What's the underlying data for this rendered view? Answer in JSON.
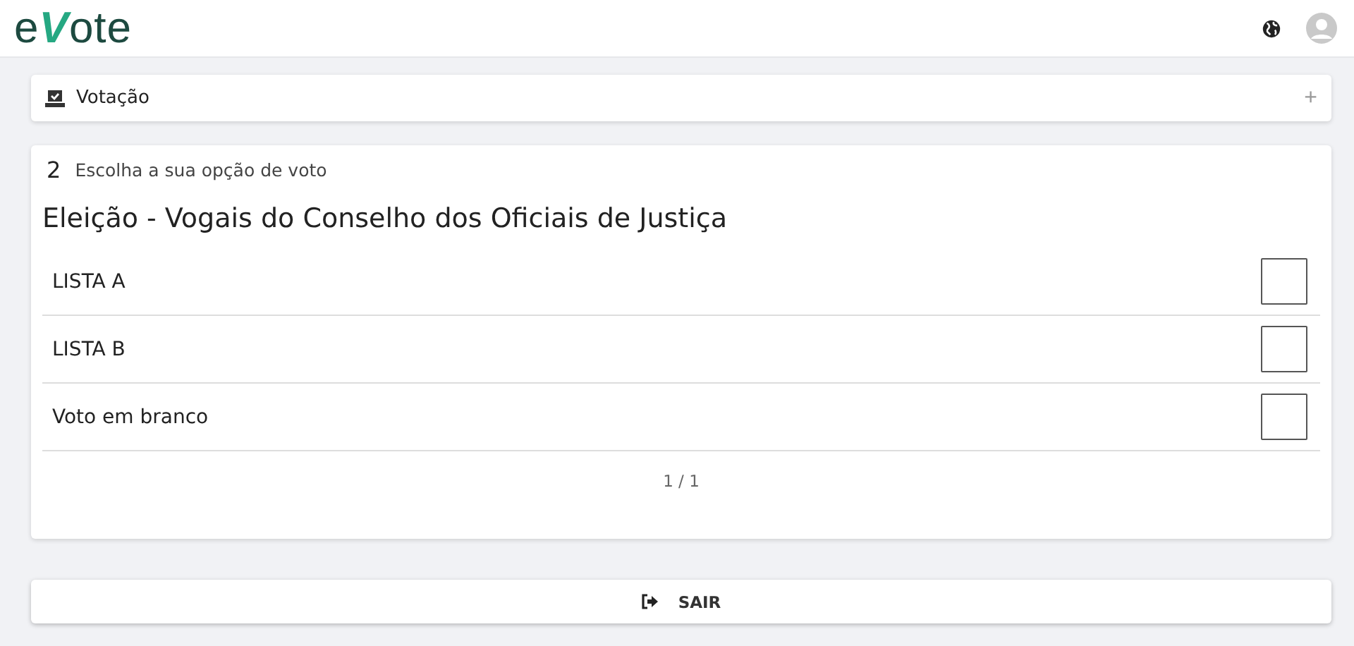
{
  "header": {
    "logo": "e**V**ote"
  },
  "accordion": {
    "title": "Votação",
    "expanded": false,
    "toggle": "+"
  },
  "ballot": {
    "step": "2",
    "instruction": "Escolha a sua opção de voto",
    "title": "Eleição - Vogais do Conselho dos Oficiais de Justiça",
    "options": [
      {
        "label": "LISTA A",
        "checked": false
      },
      {
        "label": "LISTA B",
        "checked": false
      },
      {
        "label": "Voto em branco",
        "checked": false
      }
    ],
    "pagination": "1 / 1"
  },
  "exit_button": {
    "label": "SAIR"
  }
}
